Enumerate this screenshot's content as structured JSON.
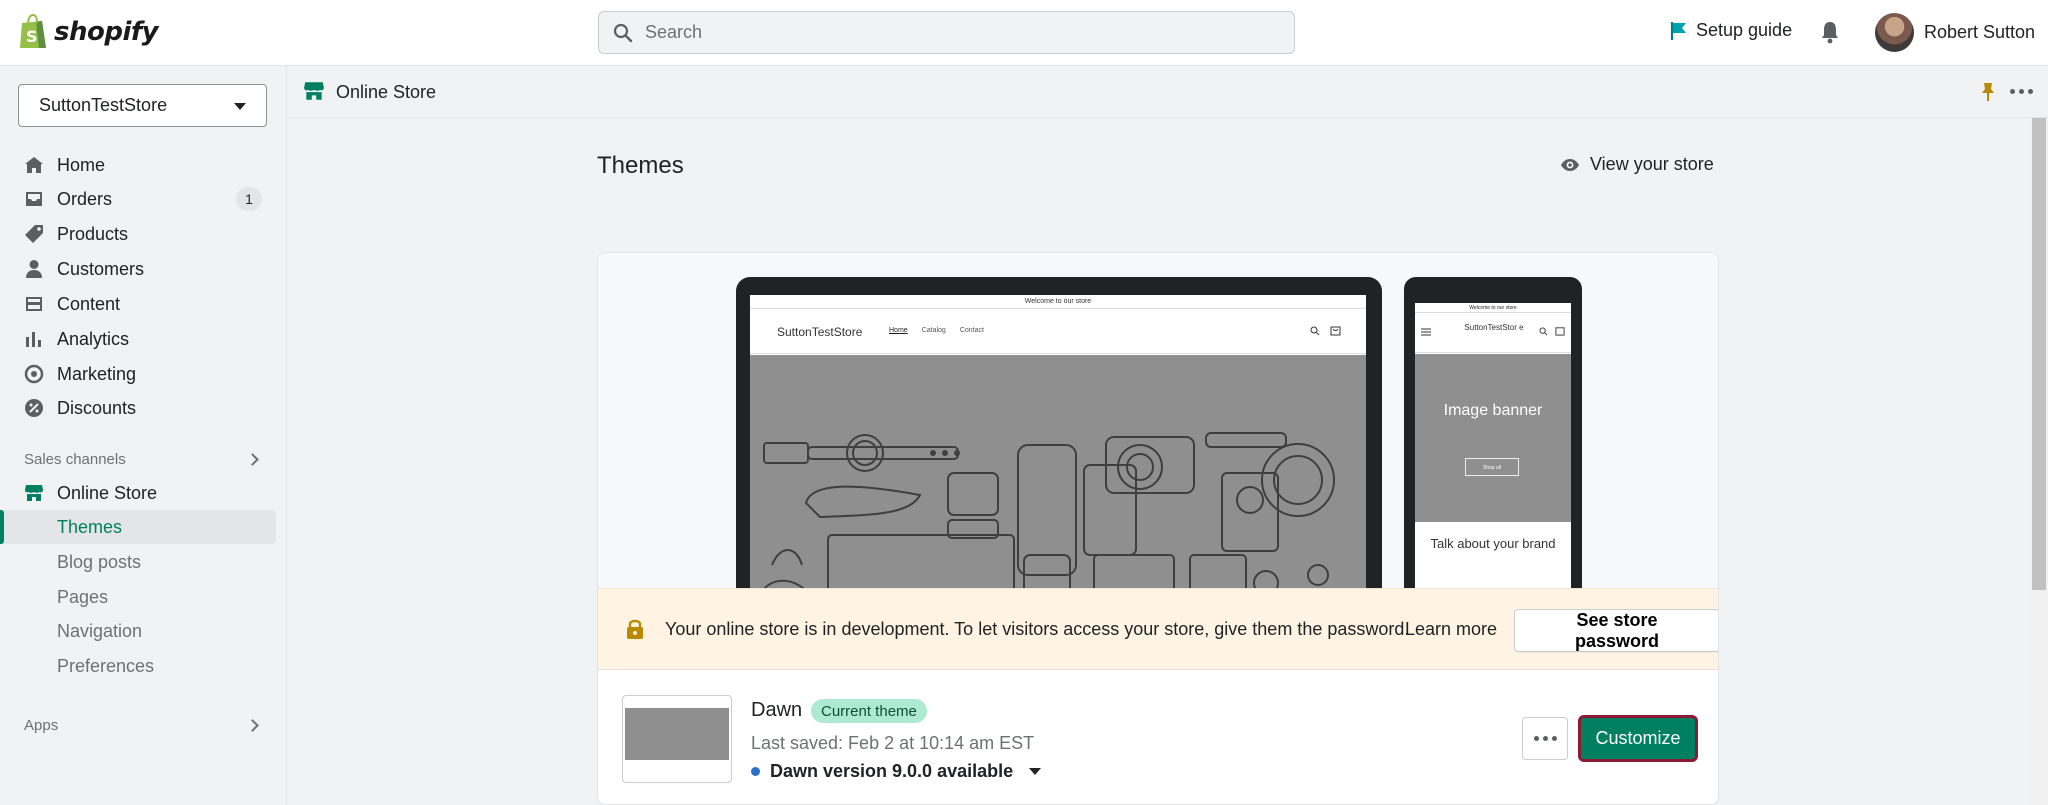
{
  "topbar": {
    "logo_text": "shopify",
    "search_placeholder": "Search",
    "setup_guide": "Setup guide",
    "user_name": "Robert Sutton"
  },
  "sidebar": {
    "store_name": "SuttonTestStore",
    "items": [
      {
        "label": "Home",
        "icon": "home-icon"
      },
      {
        "label": "Orders",
        "icon": "orders-icon",
        "badge": "1"
      },
      {
        "label": "Products",
        "icon": "tag-icon"
      },
      {
        "label": "Customers",
        "icon": "person-icon"
      },
      {
        "label": "Content",
        "icon": "content-icon"
      },
      {
        "label": "Analytics",
        "icon": "bar-chart-icon"
      },
      {
        "label": "Marketing",
        "icon": "target-icon"
      },
      {
        "label": "Discounts",
        "icon": "discount-icon"
      }
    ],
    "sales_channels_label": "Sales channels",
    "online_store_label": "Online Store",
    "sub_items": [
      "Themes",
      "Blog posts",
      "Pages",
      "Navigation",
      "Preferences"
    ],
    "apps_label": "Apps"
  },
  "subheader": {
    "title": "Online Store"
  },
  "main": {
    "page_title": "Themes",
    "view_store": "View your store",
    "preview": {
      "announcement": "Welcome to our store",
      "brand": "SuttonTestStore",
      "links": [
        "Home",
        "Catalog",
        "Contact"
      ],
      "phone_brand": "SuttonTestStor e",
      "image_banner": "Image banner",
      "shop_all": "Shop all",
      "talk_about": "Talk about your brand"
    },
    "dev_banner": {
      "message": "Your online store is in development. To let visitors access your store, give them the password.",
      "learn_more": "Learn more",
      "button": "See store password"
    },
    "theme": {
      "name": "Dawn",
      "badge": "Current theme",
      "last_saved": "Last saved: Feb 2 at 10:14 am EST",
      "version": "Dawn version 9.0.0 available",
      "customize": "Customize"
    }
  },
  "colors": {
    "accent": "#008060",
    "badge_bg": "#aee9d1",
    "dev_banner_bg": "#fff4e4",
    "focus_outline": "#8c1a35"
  }
}
